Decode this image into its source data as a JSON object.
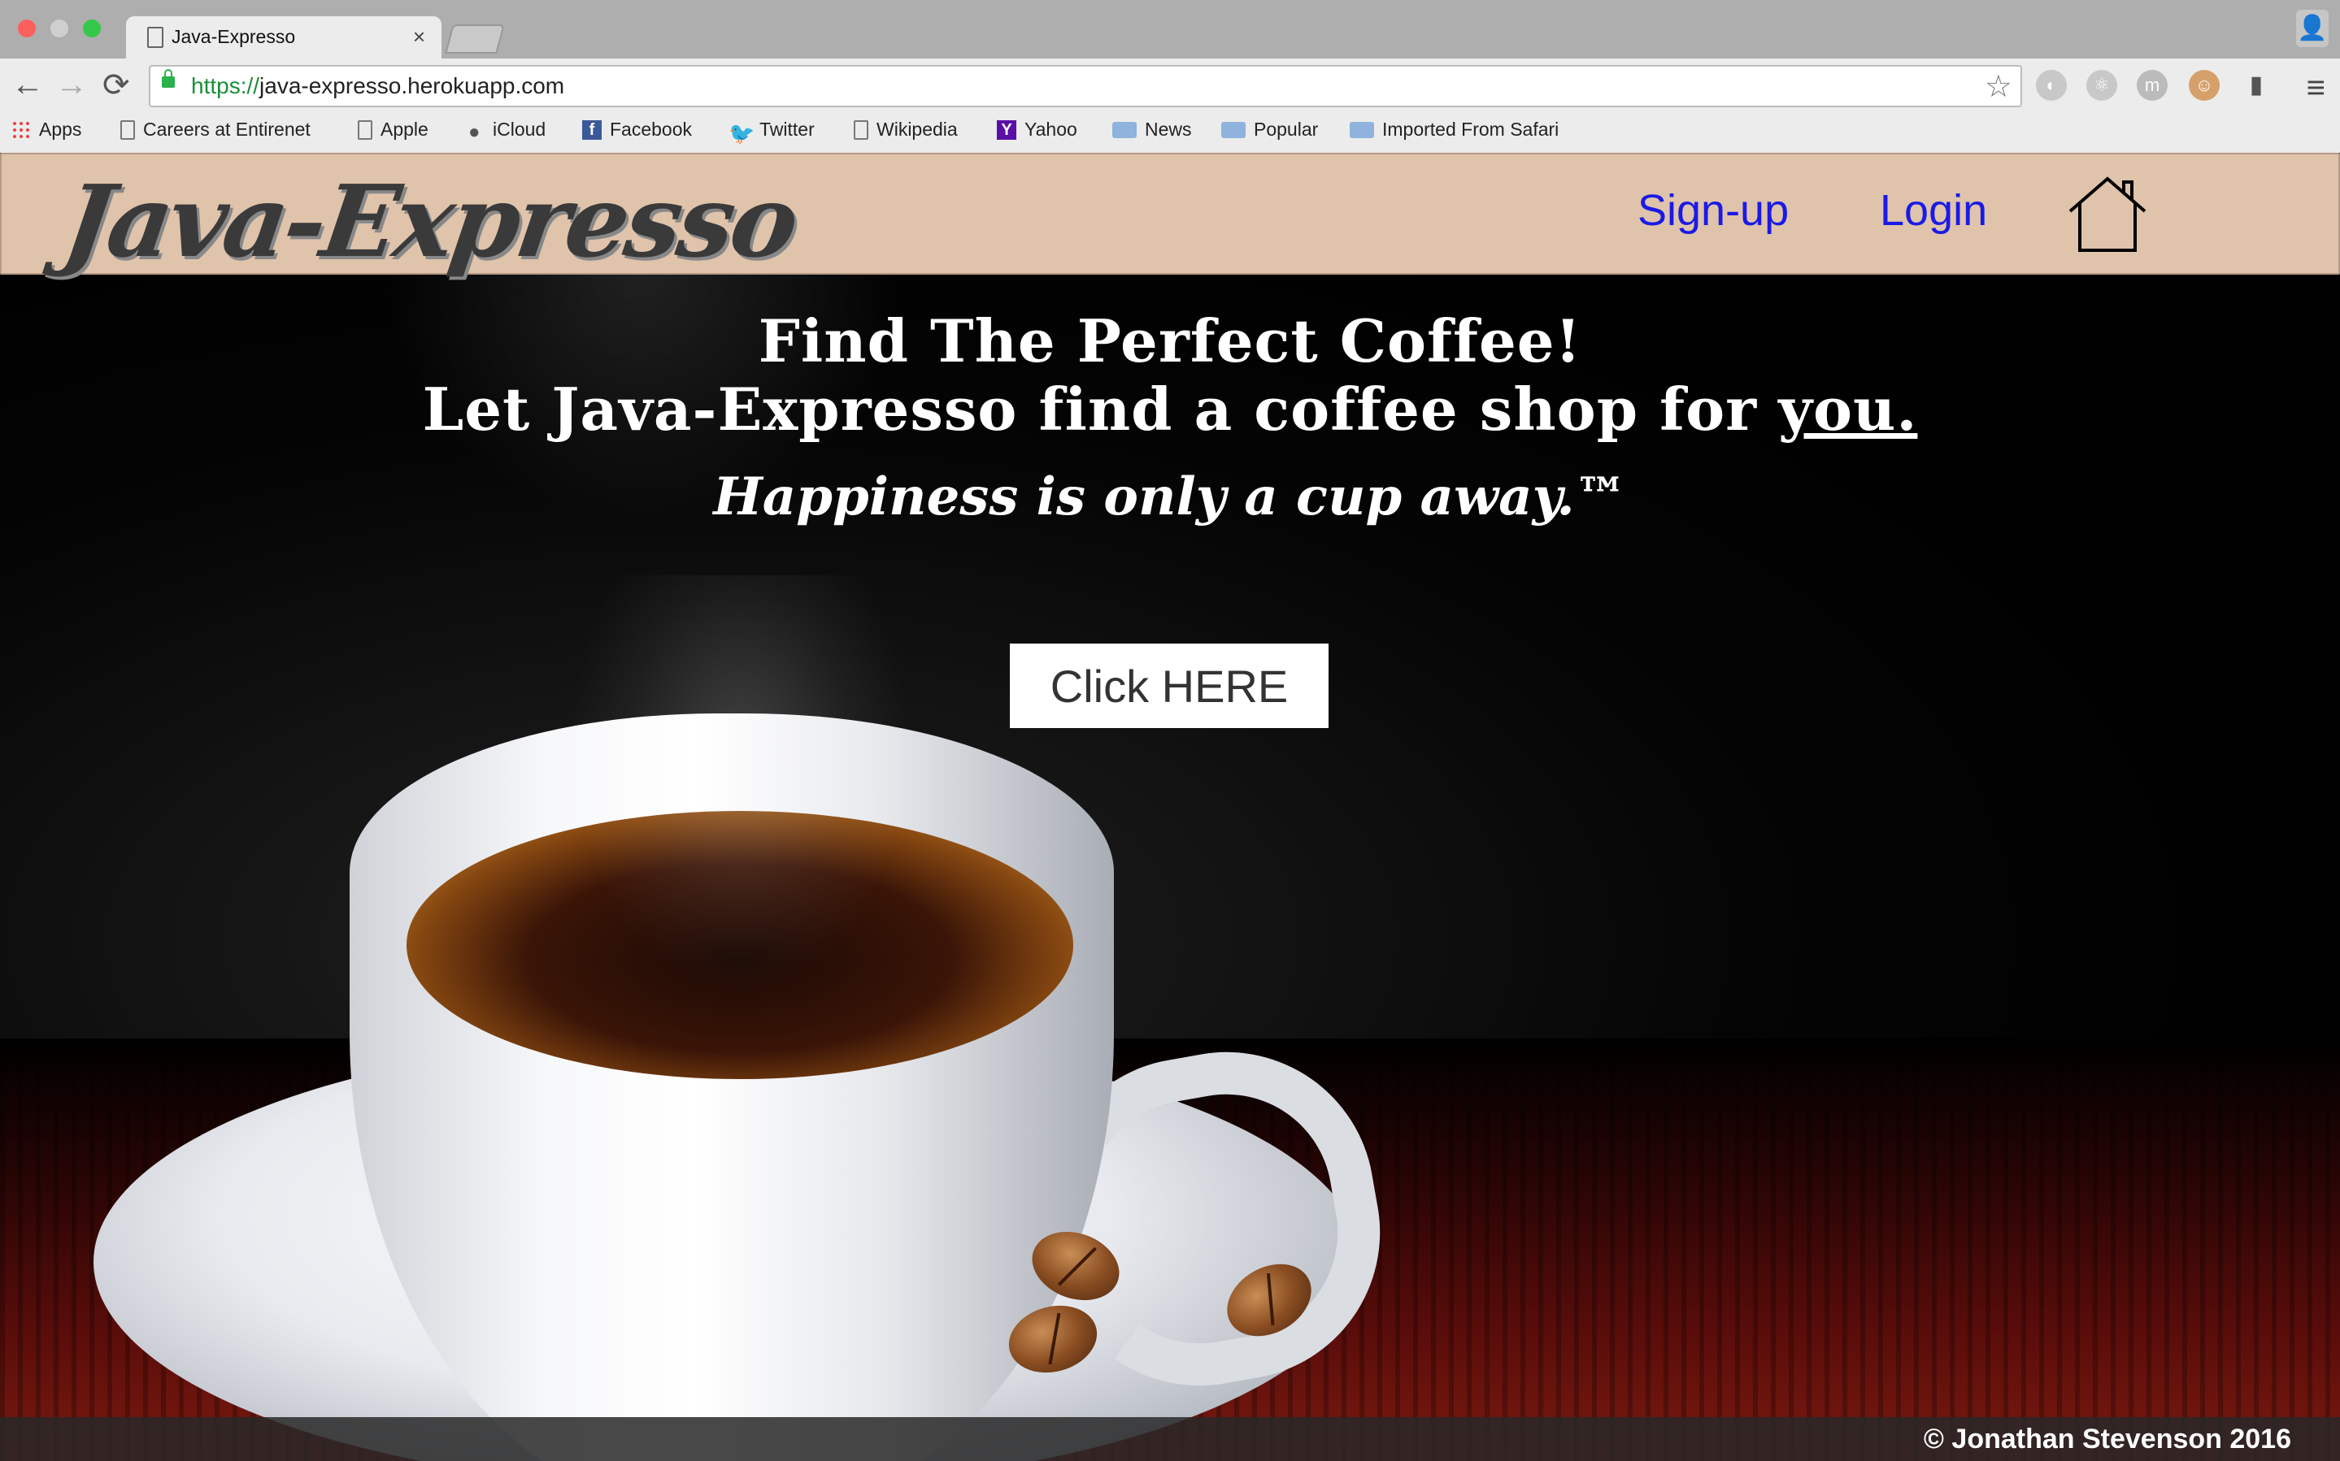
{
  "browser": {
    "tab_title": "Java-Expresso",
    "tab_close": "×",
    "url_protocol": "https://",
    "url_host": "java-expresso.herokuapp.com",
    "bookmarks": [
      {
        "label": "Apps",
        "icon": "apps-grid-icon"
      },
      {
        "label": "Careers at Entirenet",
        "icon": "page-icon"
      },
      {
        "label": "Apple",
        "icon": "page-icon"
      },
      {
        "label": "iCloud",
        "icon": "apple-icon"
      },
      {
        "label": "Facebook",
        "icon": "facebook-icon"
      },
      {
        "label": "Twitter",
        "icon": "twitter-icon"
      },
      {
        "label": "Wikipedia",
        "icon": "page-icon"
      },
      {
        "label": "Yahoo",
        "icon": "yahoo-icon"
      },
      {
        "label": "News",
        "icon": "folder-icon"
      },
      {
        "label": "Popular",
        "icon": "folder-icon"
      },
      {
        "label": "Imported From Safari",
        "icon": "folder-icon"
      }
    ]
  },
  "header": {
    "logo_text": "Java-Expresso",
    "nav_signup": "Sign-up",
    "nav_login": "Login",
    "link_color": "#1a1ae6",
    "header_bg": "#e0c3ab"
  },
  "hero": {
    "headline1": "Find The Perfect Coffee!",
    "headline2_prefix": "Let Java-Expresso find a coffee shop for ",
    "headline2_emphasis": "you.",
    "tagline": "Happiness is only a cup away.™",
    "cta_label": "Click HERE"
  },
  "footer": {
    "copyright": "© Jonathan Stevenson 2016"
  }
}
